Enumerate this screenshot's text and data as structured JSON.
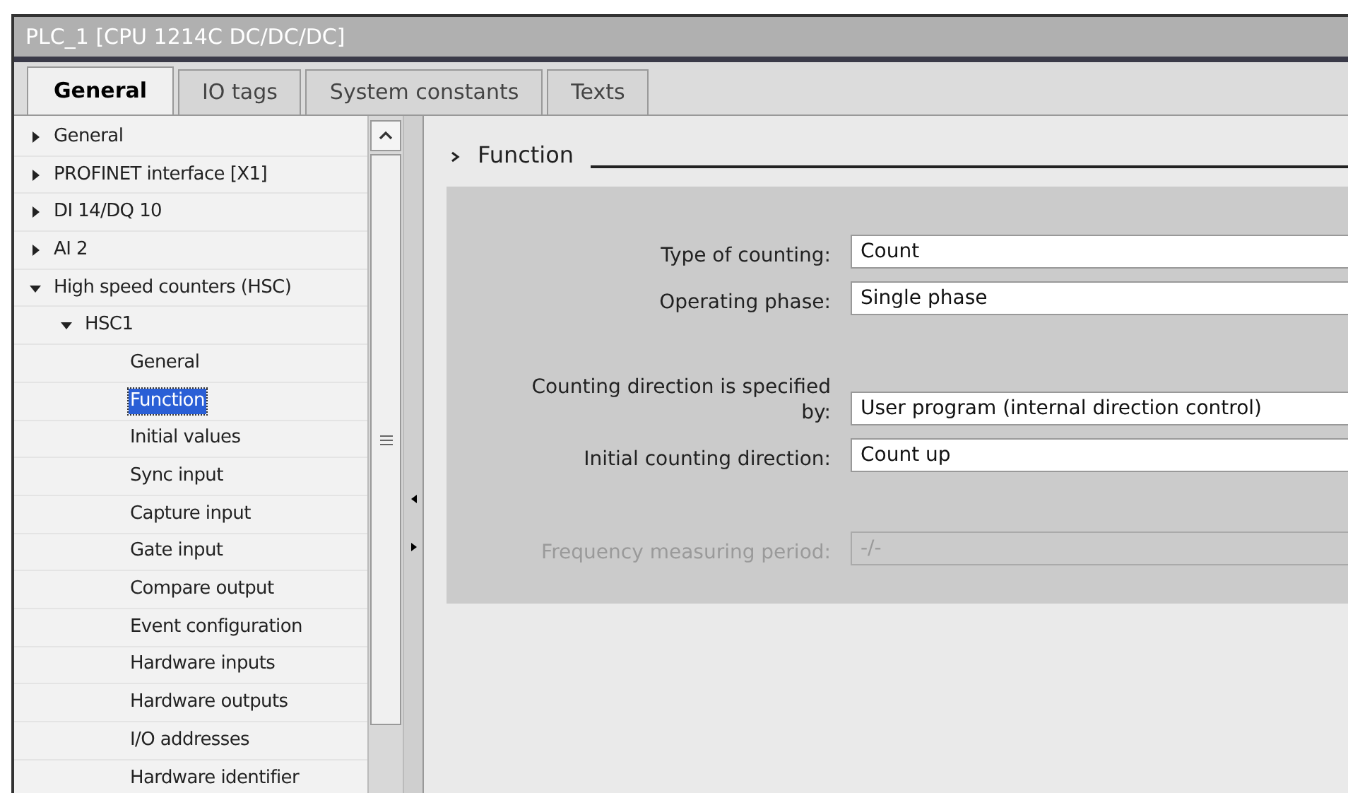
{
  "window": {
    "title": "PLC_1 [CPU 1214C DC/DC/DC]"
  },
  "tabs": [
    {
      "label": "General",
      "selected": true
    },
    {
      "label": "IO tags",
      "selected": false
    },
    {
      "label": "System constants",
      "selected": false
    },
    {
      "label": "Texts",
      "selected": false
    }
  ],
  "tree": [
    {
      "label": "General",
      "expanded": false,
      "selected": false
    },
    {
      "label": "PROFINET interface [X1]",
      "expanded": false,
      "selected": false
    },
    {
      "label": "DI 14/DQ 10",
      "expanded": false,
      "selected": false
    },
    {
      "label": "AI 2",
      "expanded": false,
      "selected": false
    },
    {
      "label": "High speed counters (HSC)",
      "expanded": true,
      "selected": false,
      "children": [
        {
          "label": "HSC1",
          "expanded": true,
          "selected": false,
          "children": [
            {
              "label": "General",
              "selected": false
            },
            {
              "label": "Function",
              "selected": true
            },
            {
              "label": "Initial values",
              "selected": false
            },
            {
              "label": "Sync input",
              "selected": false
            },
            {
              "label": "Capture input",
              "selected": false
            },
            {
              "label": "Gate input",
              "selected": false
            },
            {
              "label": "Compare output",
              "selected": false
            },
            {
              "label": "Event configuration",
              "selected": false
            },
            {
              "label": "Hardware inputs",
              "selected": false
            },
            {
              "label": "Hardware outputs",
              "selected": false
            },
            {
              "label": "I/O addresses",
              "selected": false
            },
            {
              "label": "Hardware identifier",
              "selected": false
            }
          ]
        }
      ]
    }
  ],
  "section": {
    "title": "Function"
  },
  "field_groups": [
    [
      {
        "label": "Type of counting:",
        "value": "Count",
        "disabled": false
      },
      {
        "label": "Operating phase:",
        "value": "Single phase",
        "disabled": false
      }
    ],
    [
      {
        "label": "Counting direction is specified by:",
        "value": "User program (internal direction control)",
        "disabled": false
      },
      {
        "label": "Initial counting direction:",
        "value": "Count up",
        "disabled": false
      }
    ],
    [
      {
        "label": "Frequency measuring period:",
        "value": "-/-",
        "disabled": true
      }
    ]
  ]
}
